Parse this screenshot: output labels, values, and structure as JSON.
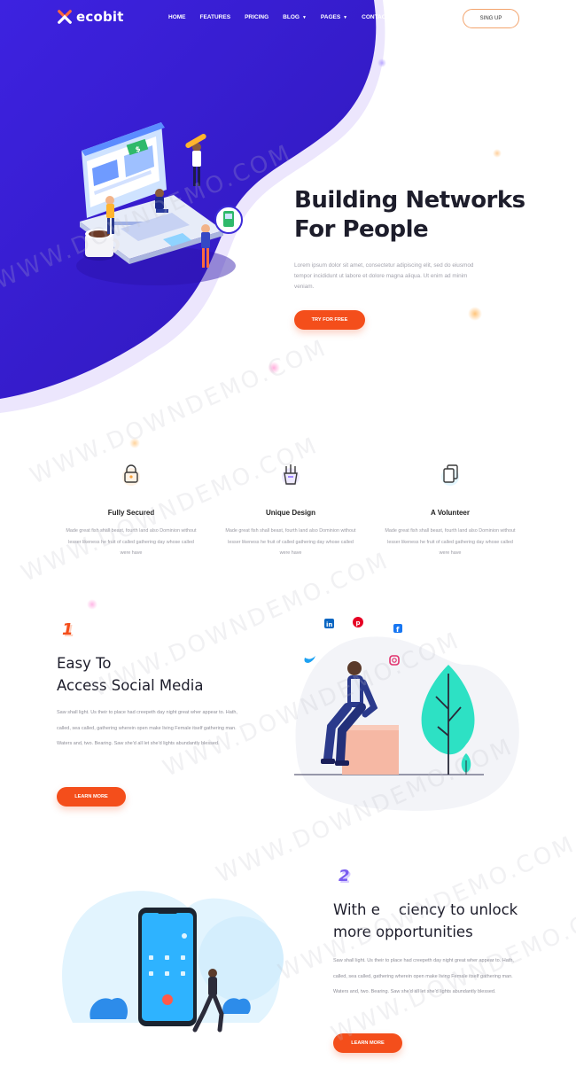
{
  "brand": {
    "name": "ecobit",
    "accent": "#f44e1b",
    "hero_purple": "#3a1bdb"
  },
  "nav": {
    "items": [
      {
        "label": "HOME",
        "caret": false
      },
      {
        "label": "FEATURES",
        "caret": false
      },
      {
        "label": "PRICING",
        "caret": false
      },
      {
        "label": "BLOG",
        "caret": true
      },
      {
        "label": "PAGES",
        "caret": true
      },
      {
        "label": "CONTACT",
        "caret": false
      }
    ],
    "signup_label": "SING UP"
  },
  "hero": {
    "title_line1": "Building Networks",
    "title_line2": "For People",
    "text": "Lorem ipsum dolor sit amet, consectetur adipiscing elit, sed do eiusmod tempor incididunt ut labore et dolore magna aliqua. Ut enim ad minim veniam.",
    "button_label": "TRY FOR FREE"
  },
  "features": [
    {
      "icon": "lock-icon",
      "title": "Fully Secured",
      "text": "Made great fish shall beast, fourth land also Dominion without lesser likeness he fruit of called gathering day whose called were have"
    },
    {
      "icon": "pencil-cup-icon",
      "title": "Unique Design",
      "text": "Made great fish shall beast, fourth land also Dominion without lesser likeness he fruit of called gathering day whose called were have"
    },
    {
      "icon": "copy-icon",
      "title": "A Volunteer",
      "text": "Made great fish shall beast, fourth land also Dominion without lesser likeness he fruit of called gathering day whose called were have"
    }
  ],
  "section1": {
    "number": "1",
    "title_line1": "Easy To",
    "title_line2": "Access Social Media",
    "text": "Saw shall light. Us their to place had creepeth day night great wher appear to. Hath, called, sea called, gathering wherein open make living Female itself gathering man. Waters and, two. Bearing. Saw she'd all let she'd lights abundantly blessed.",
    "button_label": "LEARN MORE",
    "social_icons": [
      "linkedin-icon",
      "pinterest-icon",
      "facebook-icon",
      "twitter-icon",
      "instagram-icon"
    ]
  },
  "section2": {
    "number": "2",
    "title_line1": "With e    ciency to unlock",
    "title_line2": "more opportunities",
    "text": "Saw shall light. Us their to place had creepeth day night great wher appear to. Hath, called, sea called, gathering wherein open make living Female itself gathering man. Waters and, two. Bearing. Saw she'd all let she'd lights abundantly blessed.",
    "button_label": "LEARN MORE"
  },
  "watermark_text": "WWW.DOWNDEMO.COM"
}
